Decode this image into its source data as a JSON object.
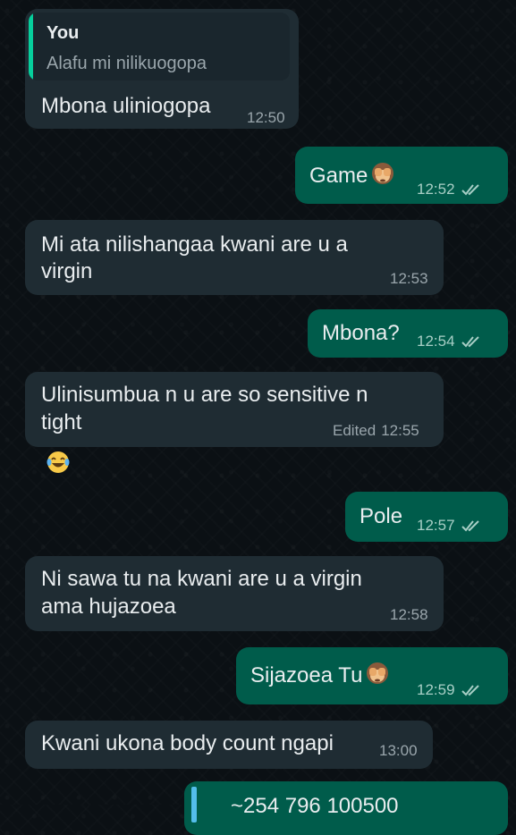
{
  "messages": [
    {
      "direction": "in",
      "quote": {
        "author": "You",
        "text": "Alafu mi nilikuogopa"
      },
      "text": "Mbona uliniogopa",
      "time": "12:50"
    },
    {
      "direction": "out",
      "text": "Game",
      "emoji": "see-no-evil-monkey",
      "time": "12:52",
      "status": "read"
    },
    {
      "direction": "in",
      "lines": [
        "Mi ata nilishangaa kwani are u a",
        "virgin"
      ],
      "time": "12:53"
    },
    {
      "direction": "out",
      "text": "Mbona?",
      "time": "12:54",
      "status": "read"
    },
    {
      "direction": "in",
      "lines": [
        "Ulinisumbua n u are so sensitive n",
        "tight"
      ],
      "edited_label": "Edited",
      "time": "12:55",
      "reaction": "face-with-tears-of-joy"
    },
    {
      "direction": "out",
      "text": "Pole",
      "time": "12:57",
      "status": "read"
    },
    {
      "direction": "in",
      "lines": [
        "Ni sawa tu na kwani are u a virgin",
        "ama hujazoea"
      ],
      "time": "12:58"
    },
    {
      "direction": "out",
      "text": "Sijazoea Tu",
      "emoji": "see-no-evil-monkey",
      "time": "12:59",
      "status": "read"
    },
    {
      "direction": "in",
      "text": "Kwani ukona body count ngapi",
      "time": "13:00"
    },
    {
      "direction": "out",
      "partial": true,
      "text": "~254 796 100500"
    }
  ],
  "colors": {
    "incoming_bubble": "#1f2c33",
    "outgoing_bubble": "#005c4b",
    "read_ticks": "#53bdeb",
    "quote_bar": "#06cf9c"
  }
}
